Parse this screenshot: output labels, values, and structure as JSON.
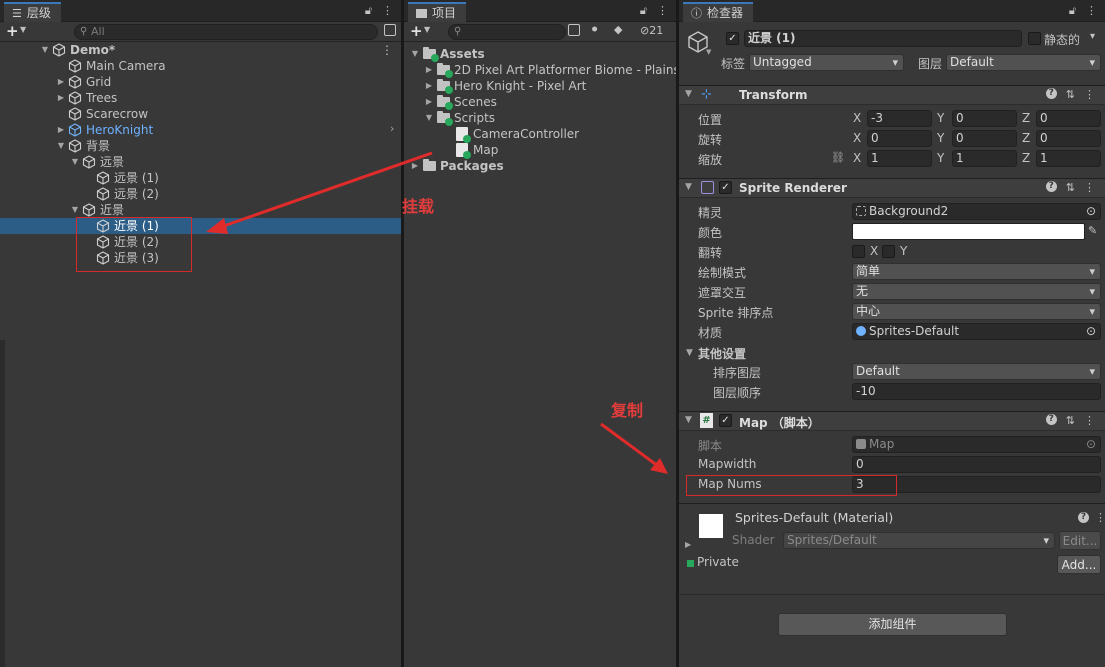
{
  "hierarchy": {
    "tab_label": "层级",
    "search_placeholder": "All",
    "items": [
      {
        "label": "Demo*",
        "depth": 0,
        "expanded": true
      },
      {
        "label": "Main Camera",
        "depth": 1
      },
      {
        "label": "Grid",
        "depth": 1,
        "collapsed": true
      },
      {
        "label": "Trees",
        "depth": 1,
        "collapsed": true
      },
      {
        "label": "Scarecrow",
        "depth": 1
      },
      {
        "label": "HeroKnight",
        "depth": 1,
        "collapsed": true,
        "prefab": true
      },
      {
        "label": "背景",
        "depth": 1,
        "expanded": true
      },
      {
        "label": "远景",
        "depth": 2,
        "expanded": true
      },
      {
        "label": "远景 (1)",
        "depth": 3
      },
      {
        "label": "远景 (2)",
        "depth": 3
      },
      {
        "label": "近景",
        "depth": 2,
        "expanded": true
      },
      {
        "label": "近景 (1)",
        "depth": 3,
        "selected": true
      },
      {
        "label": "近景 (2)",
        "depth": 3
      },
      {
        "label": "近景 (3)",
        "depth": 3
      }
    ]
  },
  "project": {
    "tab_label": "项目",
    "hidden_count": "21",
    "items": [
      {
        "label": "Assets",
        "depth": 0,
        "bold": true,
        "type": "folder"
      },
      {
        "label": "2D Pixel Art Platformer Biome - Plains",
        "depth": 1,
        "type": "folder"
      },
      {
        "label": "Hero Knight - Pixel Art",
        "depth": 1,
        "type": "folder"
      },
      {
        "label": "Scenes",
        "depth": 1,
        "type": "folder"
      },
      {
        "label": "Scripts",
        "depth": 1,
        "type": "folder"
      },
      {
        "label": "CameraController",
        "depth": 2,
        "type": "script"
      },
      {
        "label": "Map",
        "depth": 2,
        "type": "script"
      },
      {
        "label": "Packages",
        "depth": 0,
        "bold": true,
        "type": "folder"
      }
    ]
  },
  "annotations": {
    "mount": "挂载",
    "copy": "复制"
  },
  "inspector": {
    "tab_label": "检查器",
    "object_name": "近景 (1)",
    "static_label": "静态的",
    "tag_label": "标签",
    "tag_value": "Untagged",
    "layer_label": "图层",
    "layer_value": "Default",
    "transform": {
      "title": "Transform",
      "position_label": "位置",
      "rotation_label": "旋转",
      "scale_label": "缩放",
      "position": {
        "x": "-3",
        "y": "0",
        "z": "0"
      },
      "rotation": {
        "x": "0",
        "y": "0",
        "z": "0"
      },
      "scale": {
        "x": "1",
        "y": "1",
        "z": "1"
      },
      "axis_x": "X",
      "axis_y": "Y",
      "axis_z": "Z"
    },
    "sprite_renderer": {
      "title": "Sprite Renderer",
      "sprite_label": "精灵",
      "sprite_value": "Background2",
      "color_label": "颜色",
      "color_value": "#ffffff",
      "flip_label": "翻转",
      "flip_x": "X",
      "flip_y": "Y",
      "draw_mode_label": "绘制模式",
      "draw_mode_value": "简单",
      "mask_label": "遮罩交互",
      "mask_value": "无",
      "sort_point_label": "Sprite 排序点",
      "sort_point_value": "中心",
      "material_label": "材质",
      "material_value": "Sprites-Default",
      "other_settings_label": "其他设置",
      "sorting_layer_label": "排序图层",
      "sorting_layer_value": "Default",
      "order_label": "图层顺序",
      "order_value": "-10"
    },
    "map_script": {
      "title": "Map （脚本）",
      "script_label": "脚本",
      "script_value": "Map",
      "mapwidth_label": "Mapwidth",
      "mapwidth_value": "0",
      "mapnums_label": "Map Nums",
      "mapnums_value": "3"
    },
    "material": {
      "title": "Sprites-Default (Material)",
      "shader_label": "Shader",
      "shader_value": "Sprites/Default",
      "edit_label": "Edit...",
      "private_label": "Private",
      "add_label": "Add..."
    },
    "add_component_label": "添加组件"
  }
}
